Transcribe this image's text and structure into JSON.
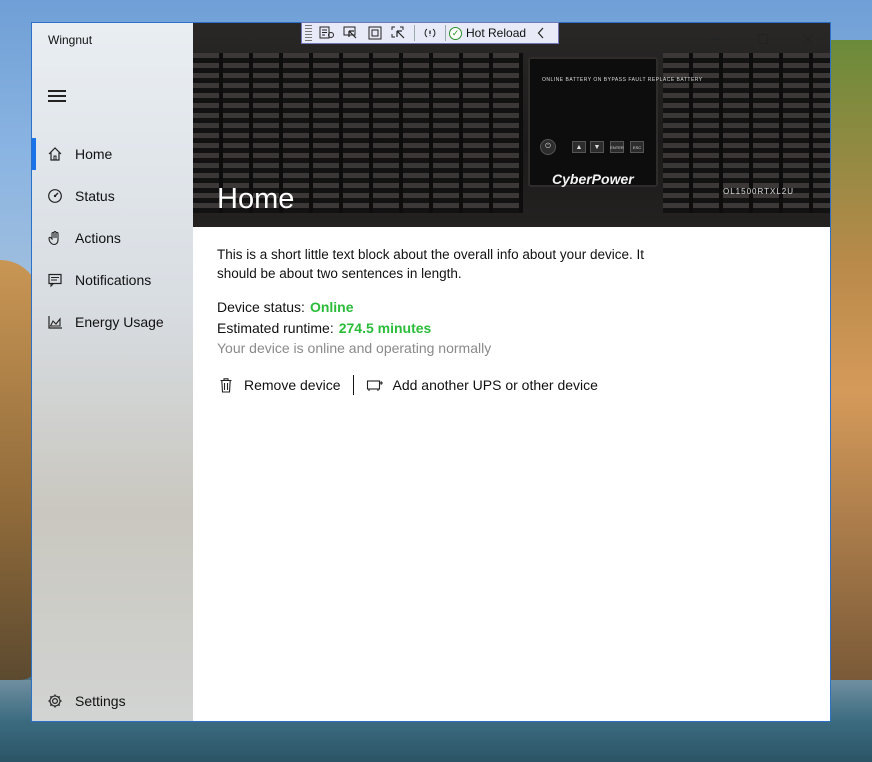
{
  "app": {
    "title": "Wingnut"
  },
  "nav": {
    "items": [
      {
        "label": "Home",
        "icon": "home-icon",
        "selected": true
      },
      {
        "label": "Status",
        "icon": "gauge-icon"
      },
      {
        "label": "Actions",
        "icon": "hand-icon"
      },
      {
        "label": "Notifications",
        "icon": "message-icon"
      },
      {
        "label": "Energy Usage",
        "icon": "area-chart-icon"
      }
    ],
    "settings_label": "Settings"
  },
  "hero": {
    "title": "Home",
    "panel_labels": "ONLINE  BATTERY ON  BYPASS  FAULT  REPLACE BATTERY",
    "brand": "CyberPower",
    "model": "OL1500RTXL2U",
    "panel_buttons": [
      "ENTER",
      "ESC"
    ]
  },
  "content": {
    "intro": "This is a short little text block about the overall info about your device. It should be about two sentences in length.",
    "device_status_label": "Device status:",
    "device_status_value": "Online",
    "runtime_label": "Estimated runtime:",
    "runtime_value": "274.5 minutes",
    "status_note": "Your device is online and operating normally"
  },
  "actions": {
    "remove_label": "Remove device",
    "add_label": "Add another UPS or other device"
  },
  "toolbar": {
    "hot_reload_label": "Hot Reload"
  },
  "colors": {
    "accent": "#1a73e8",
    "status_ok": "#2bbd3a",
    "note_gray": "#8a8a8a"
  }
}
